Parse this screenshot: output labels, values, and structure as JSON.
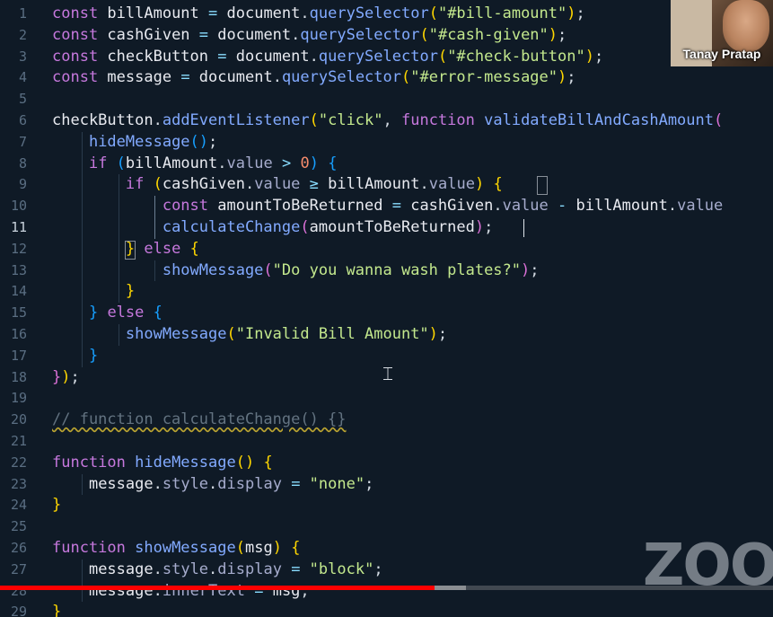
{
  "editor": {
    "active_line": 11,
    "lines": [
      {
        "n": "1",
        "tokens": [
          [
            "kw",
            "const "
          ],
          [
            "var",
            "billAmount "
          ],
          [
            "op",
            "= "
          ],
          [
            "var",
            "document"
          ],
          [
            "punc",
            "."
          ],
          [
            "fn",
            "querySelector"
          ],
          [
            "br1",
            "("
          ],
          [
            "str",
            "\"#bill-amount\""
          ],
          [
            "br1",
            ")"
          ],
          [
            "punc",
            ";"
          ]
        ]
      },
      {
        "n": "2",
        "tokens": [
          [
            "kw",
            "const "
          ],
          [
            "var",
            "cashGiven "
          ],
          [
            "op",
            "= "
          ],
          [
            "var",
            "document"
          ],
          [
            "punc",
            "."
          ],
          [
            "fn",
            "querySelector"
          ],
          [
            "br1",
            "("
          ],
          [
            "str",
            "\"#cash-given\""
          ],
          [
            "br1",
            ")"
          ],
          [
            "punc",
            ";"
          ]
        ]
      },
      {
        "n": "3",
        "tokens": [
          [
            "kw",
            "const "
          ],
          [
            "var",
            "checkButton "
          ],
          [
            "op",
            "= "
          ],
          [
            "var",
            "document"
          ],
          [
            "punc",
            "."
          ],
          [
            "fn",
            "querySelector"
          ],
          [
            "br1",
            "("
          ],
          [
            "str",
            "\"#check-button\""
          ],
          [
            "br1",
            ")"
          ],
          [
            "punc",
            ";"
          ]
        ]
      },
      {
        "n": "4",
        "tokens": [
          [
            "kw",
            "const "
          ],
          [
            "var",
            "message "
          ],
          [
            "op",
            "= "
          ],
          [
            "var",
            "document"
          ],
          [
            "punc",
            "."
          ],
          [
            "fn",
            "querySelector"
          ],
          [
            "br1",
            "("
          ],
          [
            "str",
            "\"#error-message\""
          ],
          [
            "br1",
            ")"
          ],
          [
            "punc",
            ";"
          ]
        ]
      },
      {
        "n": "5",
        "tokens": []
      },
      {
        "n": "6",
        "tokens": [
          [
            "var",
            "checkButton"
          ],
          [
            "punc",
            "."
          ],
          [
            "fn",
            "addEventListener"
          ],
          [
            "br1",
            "("
          ],
          [
            "str",
            "\"click\""
          ],
          [
            "punc",
            ", "
          ],
          [
            "kw",
            "function "
          ],
          [
            "fn",
            "validateBillAndCashAmount"
          ],
          [
            "br2",
            "("
          ]
        ]
      },
      {
        "n": "7",
        "tokens": [
          [
            "punc",
            "    "
          ],
          [
            "fn",
            "hideMessage"
          ],
          [
            "br3",
            "("
          ],
          [
            "br3",
            ")"
          ],
          [
            "punc",
            ";"
          ]
        ]
      },
      {
        "n": "8",
        "tokens": [
          [
            "punc",
            "    "
          ],
          [
            "kw",
            "if "
          ],
          [
            "br3",
            "("
          ],
          [
            "var",
            "billAmount"
          ],
          [
            "punc",
            "."
          ],
          [
            "prop",
            "value "
          ],
          [
            "op",
            "> "
          ],
          [
            "num",
            "0"
          ],
          [
            "br3",
            ")"
          ],
          [
            "punc",
            " "
          ],
          [
            "br3",
            "{"
          ]
        ]
      },
      {
        "n": "9",
        "tokens": [
          [
            "punc",
            "        "
          ],
          [
            "kw",
            "if "
          ],
          [
            "br1",
            "("
          ],
          [
            "var",
            "cashGiven"
          ],
          [
            "punc",
            "."
          ],
          [
            "prop",
            "value "
          ],
          [
            "op",
            "≥ "
          ],
          [
            "var",
            "billAmount"
          ],
          [
            "punc",
            "."
          ],
          [
            "prop",
            "value"
          ],
          [
            "br1",
            ")"
          ],
          [
            "punc",
            " "
          ],
          [
            "br1",
            "{"
          ]
        ]
      },
      {
        "n": "10",
        "tokens": [
          [
            "punc",
            "            "
          ],
          [
            "kw",
            "const "
          ],
          [
            "var",
            "amountToBeReturned "
          ],
          [
            "op",
            "= "
          ],
          [
            "var",
            "cashGiven"
          ],
          [
            "punc",
            "."
          ],
          [
            "prop",
            "value "
          ],
          [
            "op",
            "- "
          ],
          [
            "var",
            "billAmount"
          ],
          [
            "punc",
            "."
          ],
          [
            "prop",
            "value"
          ]
        ]
      },
      {
        "n": "11",
        "tokens": [
          [
            "punc",
            "            "
          ],
          [
            "fn",
            "calculateChange"
          ],
          [
            "br2",
            "("
          ],
          [
            "var",
            "amountToBeReturned"
          ],
          [
            "br2",
            ")"
          ],
          [
            "punc",
            ";"
          ]
        ]
      },
      {
        "n": "12",
        "tokens": [
          [
            "punc",
            "        "
          ],
          [
            "br1",
            "}"
          ],
          [
            "kw",
            " else "
          ],
          [
            "br1",
            "{"
          ]
        ]
      },
      {
        "n": "13",
        "tokens": [
          [
            "punc",
            "            "
          ],
          [
            "fn",
            "showMessage"
          ],
          [
            "br2",
            "("
          ],
          [
            "str",
            "\"Do you wanna wash plates?\""
          ],
          [
            "br2",
            ")"
          ],
          [
            "punc",
            ";"
          ]
        ]
      },
      {
        "n": "14",
        "tokens": [
          [
            "punc",
            "        "
          ],
          [
            "br1",
            "}"
          ]
        ]
      },
      {
        "n": "15",
        "tokens": [
          [
            "punc",
            "    "
          ],
          [
            "br3",
            "}"
          ],
          [
            "kw",
            " else "
          ],
          [
            "br3",
            "{"
          ]
        ]
      },
      {
        "n": "16",
        "tokens": [
          [
            "punc",
            "        "
          ],
          [
            "fn",
            "showMessage"
          ],
          [
            "br1",
            "("
          ],
          [
            "str",
            "\"Invalid Bill Amount\""
          ],
          [
            "br1",
            ")"
          ],
          [
            "punc",
            ";"
          ]
        ]
      },
      {
        "n": "17",
        "tokens": [
          [
            "punc",
            "    "
          ],
          [
            "br3",
            "}"
          ]
        ]
      },
      {
        "n": "18",
        "tokens": [
          [
            "br2",
            "}"
          ],
          [
            "br1",
            ")"
          ],
          [
            "punc",
            ";"
          ]
        ]
      },
      {
        "n": "19",
        "tokens": []
      },
      {
        "n": "20",
        "tokens": [
          [
            "comment",
            "// function calculateChange() {}"
          ]
        ]
      },
      {
        "n": "21",
        "tokens": []
      },
      {
        "n": "22",
        "tokens": [
          [
            "kw",
            "function "
          ],
          [
            "fn",
            "hideMessage"
          ],
          [
            "br1",
            "("
          ],
          [
            "br1",
            ")"
          ],
          [
            "punc",
            " "
          ],
          [
            "br1",
            "{"
          ]
        ]
      },
      {
        "n": "23",
        "tokens": [
          [
            "punc",
            "    "
          ],
          [
            "var",
            "message"
          ],
          [
            "punc",
            "."
          ],
          [
            "prop",
            "style"
          ],
          [
            "punc",
            "."
          ],
          [
            "prop",
            "display "
          ],
          [
            "op",
            "= "
          ],
          [
            "str",
            "\"none\""
          ],
          [
            "punc",
            ";"
          ]
        ]
      },
      {
        "n": "24",
        "tokens": [
          [
            "br1",
            "}"
          ]
        ]
      },
      {
        "n": "25",
        "tokens": []
      },
      {
        "n": "26",
        "tokens": [
          [
            "kw",
            "function "
          ],
          [
            "fn",
            "showMessage"
          ],
          [
            "br1",
            "("
          ],
          [
            "var",
            "msg"
          ],
          [
            "br1",
            ")"
          ],
          [
            "punc",
            " "
          ],
          [
            "br1",
            "{"
          ]
        ]
      },
      {
        "n": "27",
        "tokens": [
          [
            "punc",
            "    "
          ],
          [
            "var",
            "message"
          ],
          [
            "punc",
            "."
          ],
          [
            "prop",
            "style"
          ],
          [
            "punc",
            "."
          ],
          [
            "prop",
            "display "
          ],
          [
            "op",
            "= "
          ],
          [
            "str",
            "\"block\""
          ],
          [
            "punc",
            ";"
          ]
        ]
      },
      {
        "n": "28",
        "tokens": [
          [
            "punc",
            "    "
          ],
          [
            "var",
            "message"
          ],
          [
            "punc",
            "."
          ],
          [
            "prop",
            "innerText "
          ],
          [
            "op",
            "= "
          ],
          [
            "var",
            "msg"
          ],
          [
            "punc",
            ";"
          ]
        ]
      },
      {
        "n": "29",
        "tokens": [
          [
            "br1",
            "}"
          ]
        ]
      }
    ]
  },
  "webcam": {
    "name": "Tanay Pratap"
  },
  "watermark": {
    "text": "ZOO"
  },
  "video": {
    "progress_played_fraction": 0.562,
    "progress_buffered_fraction": 0.603
  },
  "colors": {
    "background": "#0f1a26",
    "keyword": "#c678dd",
    "function": "#82aaff",
    "string": "#c3e88d",
    "progress": "#ff0000"
  }
}
